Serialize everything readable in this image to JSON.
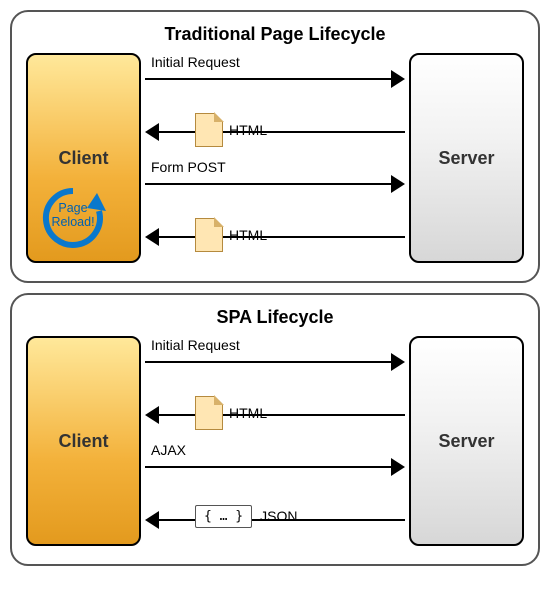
{
  "panels": [
    {
      "title": "Traditional Page Lifecycle",
      "client": "Client",
      "server": "Server",
      "reload_badge": "Page\nReload!",
      "lanes": [
        {
          "dir": "right",
          "label": "Initial Request"
        },
        {
          "dir": "left",
          "doc": true,
          "doc_label": "HTML"
        },
        {
          "dir": "right",
          "label": "Form POST"
        },
        {
          "dir": "left",
          "doc": true,
          "doc_label": "HTML"
        }
      ]
    },
    {
      "title": "SPA Lifecycle",
      "client": "Client",
      "server": "Server",
      "lanes": [
        {
          "dir": "right",
          "label": "Initial Request"
        },
        {
          "dir": "left",
          "doc": true,
          "doc_label": "HTML"
        },
        {
          "dir": "right",
          "label": "AJAX"
        },
        {
          "dir": "left",
          "json": true,
          "json_text": "{ … }",
          "json_label": "JSON"
        }
      ]
    }
  ],
  "chart_data": {
    "type": "diagram",
    "description": "Two sequence-style diagrams comparing request/response flows between a Client box and a Server box.",
    "diagrams": [
      {
        "title": "Traditional Page Lifecycle",
        "left_node": "Client",
        "right_node": "Server",
        "client_badge": "Page Reload!",
        "messages": [
          {
            "from": "Client",
            "to": "Server",
            "label": "Initial Request"
          },
          {
            "from": "Server",
            "to": "Client",
            "payload": "HTML"
          },
          {
            "from": "Client",
            "to": "Server",
            "label": "Form POST"
          },
          {
            "from": "Server",
            "to": "Client",
            "payload": "HTML"
          }
        ]
      },
      {
        "title": "SPA Lifecycle",
        "left_node": "Client",
        "right_node": "Server",
        "messages": [
          {
            "from": "Client",
            "to": "Server",
            "label": "Initial Request"
          },
          {
            "from": "Server",
            "to": "Client",
            "payload": "HTML"
          },
          {
            "from": "Client",
            "to": "Server",
            "label": "AJAX"
          },
          {
            "from": "Server",
            "to": "Client",
            "payload": "JSON",
            "body": "{ … }"
          }
        ]
      }
    ]
  }
}
